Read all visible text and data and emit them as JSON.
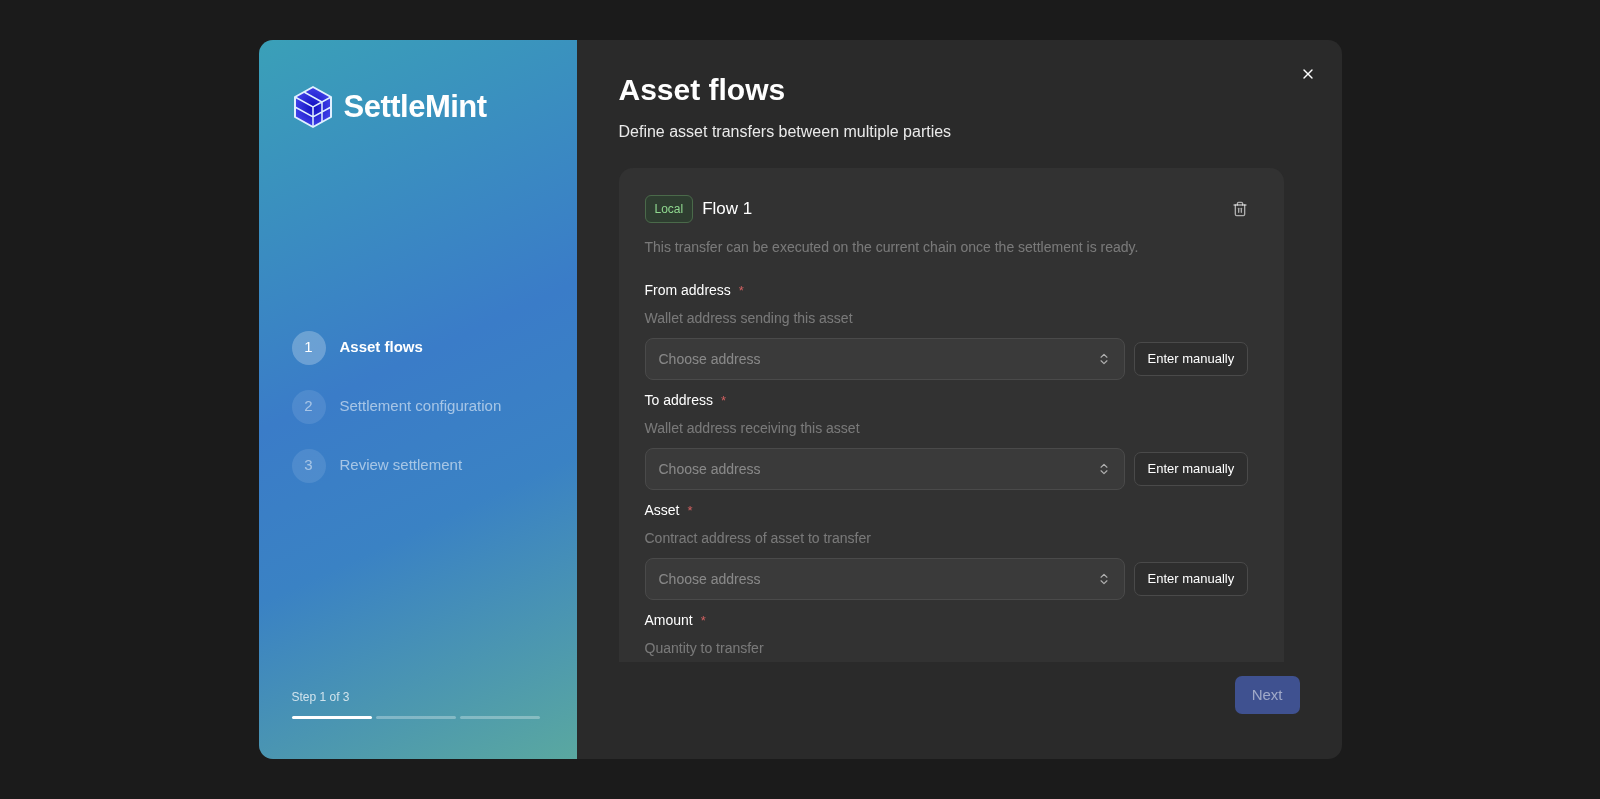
{
  "brand": {
    "name": "SettleMint"
  },
  "steps": [
    {
      "number": "1",
      "label": "Asset flows",
      "selected": true
    },
    {
      "number": "2",
      "label": "Settlement configuration",
      "selected": false
    },
    {
      "number": "3",
      "label": "Review settlement",
      "selected": false
    }
  ],
  "progress": {
    "label": "Step 1 of 3",
    "segments": [
      {
        "filled": true
      },
      {
        "filled": false
      },
      {
        "filled": false
      }
    ]
  },
  "header": {
    "title": "Asset flows",
    "subtitle": "Define asset transfers between multiple parties"
  },
  "flow": {
    "badge": "Local",
    "title": "Flow 1",
    "description": "This transfer can be executed on the current chain once the settlement is ready.",
    "fields": [
      {
        "kind": "select",
        "label": "From address",
        "required_mark": "*",
        "hint": "Wallet address sending this asset",
        "placeholder": "Choose address",
        "button": "Enter manually"
      },
      {
        "kind": "select",
        "label": "To address",
        "required_mark": "*",
        "hint": "Wallet address receiving this asset",
        "placeholder": "Choose address",
        "button": "Enter manually"
      },
      {
        "kind": "select",
        "label": "Asset",
        "required_mark": "*",
        "hint": "Contract address of asset to transfer",
        "placeholder": "Choose address",
        "button": "Enter manually"
      },
      {
        "kind": "text",
        "label": "Amount",
        "required_mark": "*",
        "hint": "Quantity to transfer"
      }
    ]
  },
  "next": {
    "label": "Next",
    "disabled": true
  }
}
